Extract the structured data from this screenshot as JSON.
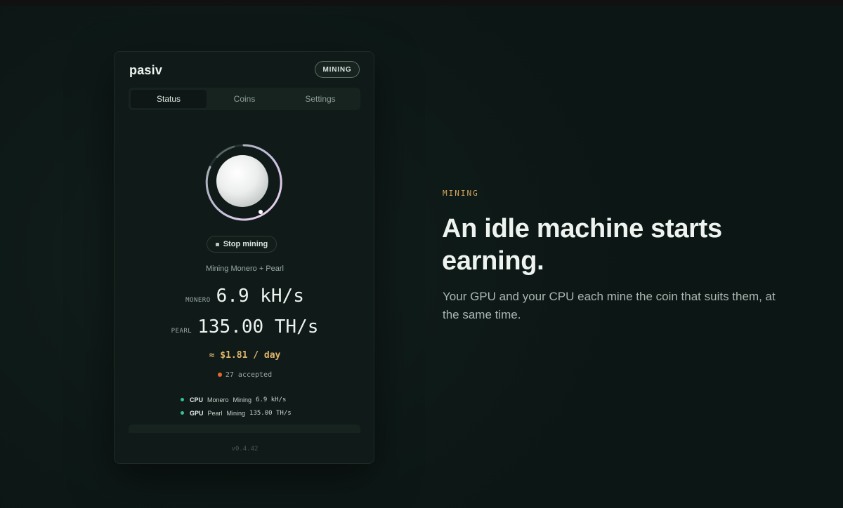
{
  "app": {
    "brand": "pasiv",
    "status_badge": "MINING",
    "tabs": [
      {
        "label": "Status",
        "active": true
      },
      {
        "label": "Coins",
        "active": false
      },
      {
        "label": "Settings",
        "active": false
      }
    ],
    "stop_button_label": "Stop mining",
    "mining_text": "Mining Monero + Pearl",
    "rates": [
      {
        "label": "MONERO",
        "value": "6.9 kH/s"
      },
      {
        "label": "PEARL",
        "value": "135.00 TH/s"
      }
    ],
    "per_day": "≈ $1.81 / day",
    "accepted": "27 accepted",
    "workers": [
      {
        "device": "CPU",
        "coin": "Monero",
        "status": "Mining",
        "rate": "6.9 kH/s"
      },
      {
        "device": "GPU",
        "coin": "Pearl",
        "status": "Mining",
        "rate": "135.00 TH/s"
      }
    ],
    "version": "v0.4.42"
  },
  "hero": {
    "eyebrow": "MINING",
    "headline": "An idle machine starts earning.",
    "subcopy": "Your GPU and your CPU each mine the coin that suits them, at the same time."
  },
  "colors": {
    "accent_gold": "#e0b56b",
    "eyebrow_gold": "#d3a55c",
    "worker_active": "#35c09a",
    "accepted_dot": "#e36a2f",
    "background": "#0d1816"
  },
  "icons": {
    "orb": "mining-orb-icon",
    "stop": "stop-square-icon",
    "status_dot": "status-dot-icon"
  }
}
